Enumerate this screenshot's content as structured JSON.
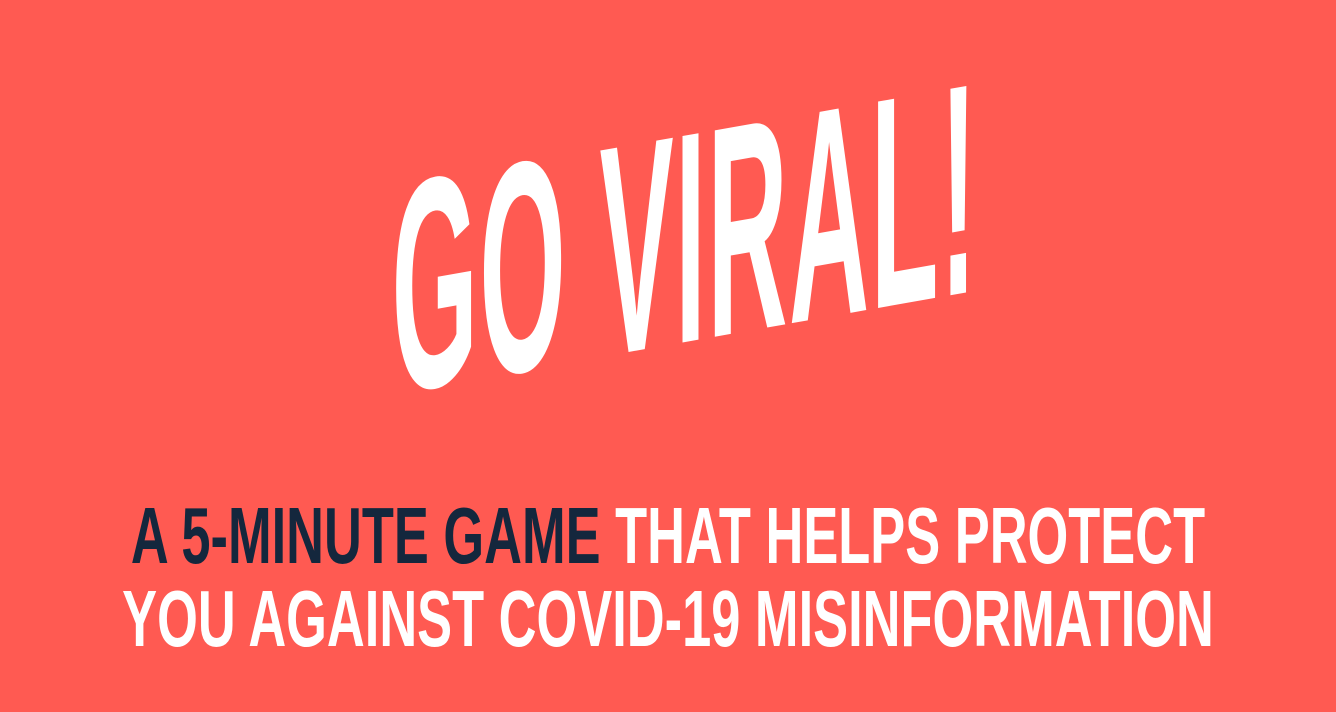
{
  "logo": {
    "text": "GO VIRAL!"
  },
  "tagline": {
    "line1_dark": "A 5-MINUTE GAME",
    "line1_white": " THAT HELPS PROTECT",
    "line2": "YOU AGAINST COVID-19 MISINFORMATION"
  },
  "colors": {
    "background": "#FF5A52",
    "accent_text": "#14273D",
    "text": "#FFFFFF"
  }
}
